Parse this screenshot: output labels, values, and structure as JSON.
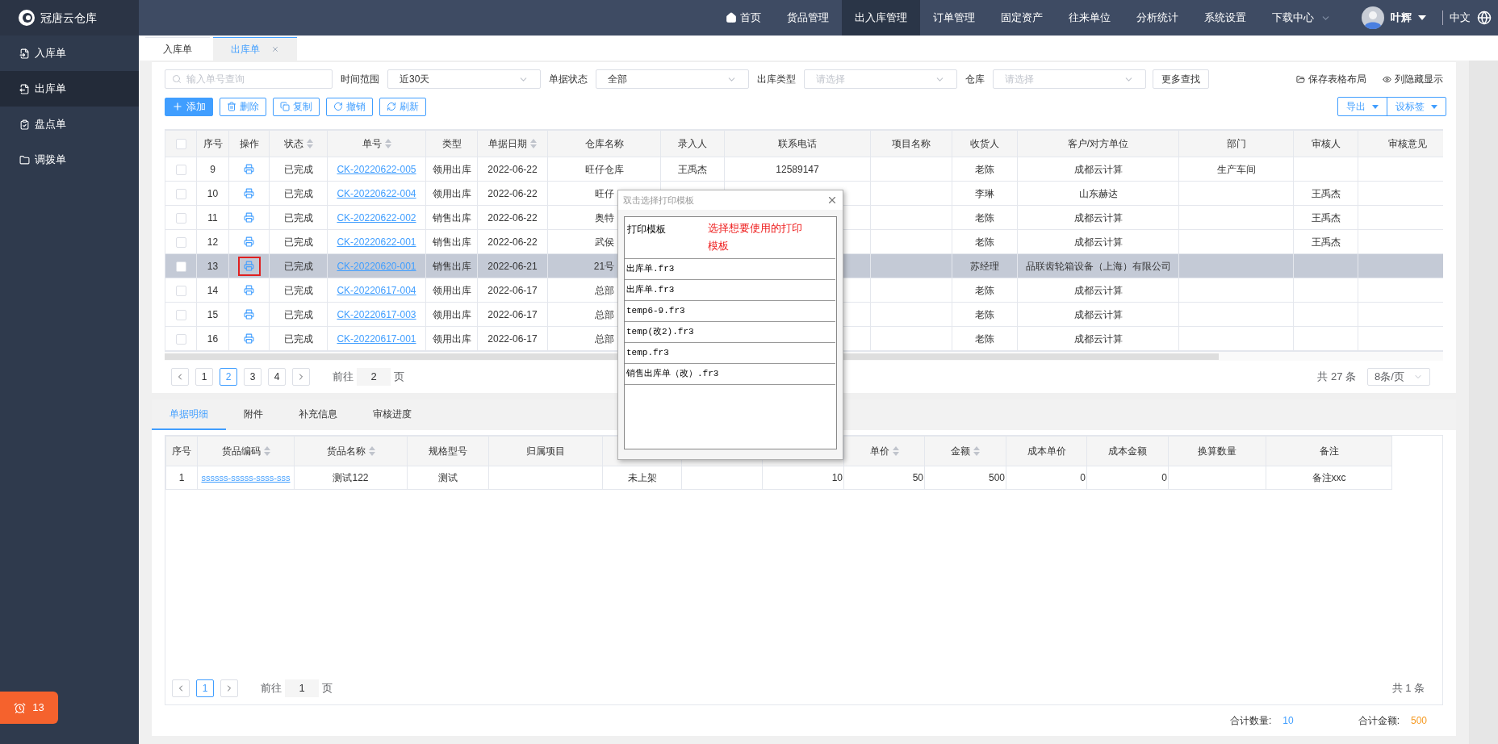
{
  "app": {
    "name": "冠唐云仓库"
  },
  "nav": [
    {
      "label": "首页",
      "selected": false,
      "kind": "home"
    },
    {
      "label": "货品管理",
      "selected": false,
      "kind": "plain"
    },
    {
      "label": "出入库管理",
      "selected": true,
      "kind": "plain"
    },
    {
      "label": "订单管理",
      "selected": false,
      "kind": "plain"
    },
    {
      "label": "固定资产",
      "selected": false,
      "kind": "plain"
    },
    {
      "label": "往来单位",
      "selected": false,
      "kind": "plain"
    },
    {
      "label": "分析统计",
      "selected": false,
      "kind": "plain"
    },
    {
      "label": "系统设置",
      "selected": false,
      "kind": "plain"
    },
    {
      "label": "下载中心",
      "selected": false,
      "kind": "dropdown"
    }
  ],
  "user": {
    "name": "叶辉"
  },
  "language": "中文",
  "sidebar": [
    {
      "label": "入库单",
      "selected": false
    },
    {
      "label": "出库单",
      "selected": true
    },
    {
      "label": "盘点单",
      "selected": false
    },
    {
      "label": "调拨单",
      "selected": false
    }
  ],
  "notification": {
    "count": "13"
  },
  "tabs": [
    {
      "label": "入库单",
      "selected": false,
      "closable": false
    },
    {
      "label": "出库单",
      "selected": true,
      "closable": true
    }
  ],
  "filters": {
    "search_placeholder": "输入单号查询",
    "fields": [
      {
        "label": "时间范围",
        "value": "近30天"
      },
      {
        "label": "单据状态",
        "value": "全部"
      },
      {
        "label": "出库类型",
        "placeholder": "请选择"
      },
      {
        "label": "仓库",
        "placeholder": "请选择"
      }
    ],
    "more": "更多查找"
  },
  "layout_actions": [
    {
      "label": "保存表格布局",
      "kind": "folder"
    },
    {
      "label": "列隐藏显示",
      "kind": "eye"
    }
  ],
  "toolbar": [
    {
      "label": "添加",
      "kind": "add"
    },
    {
      "label": "删除",
      "kind": "delete"
    },
    {
      "label": "复制",
      "kind": "copy"
    },
    {
      "label": "撤销",
      "kind": "undo"
    },
    {
      "label": "刷新",
      "kind": "refresh"
    }
  ],
  "toolbar_right": [
    {
      "label": "导出"
    },
    {
      "label": "设标签"
    }
  ],
  "table": {
    "all_checked": false,
    "columns": [
      {
        "label": "序号",
        "sortable": false
      },
      {
        "label": "操作",
        "sortable": false,
        "kind": "print"
      },
      {
        "label": "状态",
        "sortable": true
      },
      {
        "label": "单号",
        "sortable": true
      },
      {
        "label": "类型",
        "sortable": false
      },
      {
        "label": "单据日期",
        "sortable": true
      },
      {
        "label": "仓库名称",
        "sortable": false
      },
      {
        "label": "录入人",
        "sortable": false
      },
      {
        "label": "联系电话",
        "sortable": false
      },
      {
        "label": "项目名称",
        "sortable": false
      },
      {
        "label": "收货人",
        "sortable": false
      },
      {
        "label": "客户/对方单位",
        "sortable": false
      },
      {
        "label": "部门",
        "sortable": false
      },
      {
        "label": "审核人",
        "sortable": false
      },
      {
        "label": "审核意见",
        "sortable": false
      }
    ],
    "rows": [
      {
        "selected": false,
        "checked": false,
        "print_marked": false,
        "cells": [
          "9",
          "",
          "已完成",
          "CK-20220622-005",
          "领用出库",
          "2022-06-22",
          "旺仔仓库",
          "王禹杰",
          "12589147",
          "",
          "老陈",
          "成都云计算",
          "生产车间",
          "",
          ""
        ]
      },
      {
        "selected": false,
        "checked": false,
        "print_marked": false,
        "cells": [
          "10",
          "",
          "已完成",
          "CK-20220622-004",
          "领用出库",
          "2022-06-22",
          "旺仔",
          "",
          "",
          "",
          "李琳",
          "山东赫达",
          "",
          "王禹杰",
          ""
        ]
      },
      {
        "selected": false,
        "checked": false,
        "print_marked": false,
        "cells": [
          "11",
          "",
          "已完成",
          "CK-20220622-002",
          "销售出库",
          "2022-06-22",
          "奥特",
          "",
          "",
          "",
          "老陈",
          "成都云计算",
          "",
          "王禹杰",
          ""
        ]
      },
      {
        "selected": false,
        "checked": false,
        "print_marked": false,
        "cells": [
          "12",
          "",
          "已完成",
          "CK-20220622-001",
          "销售出库",
          "2022-06-22",
          "武侯",
          "",
          "",
          "",
          "老陈",
          "成都云计算",
          "",
          "王禹杰",
          ""
        ]
      },
      {
        "selected": true,
        "checked": false,
        "print_marked": true,
        "cells": [
          "13",
          "",
          "已完成",
          "CK-20220620-001",
          "销售出库",
          "2022-06-21",
          "21号",
          "",
          "",
          "",
          "苏经理",
          "品联齿轮箱设备（上海）有限公司",
          "",
          "",
          ""
        ]
      },
      {
        "selected": false,
        "checked": false,
        "print_marked": false,
        "cells": [
          "14",
          "",
          "已完成",
          "CK-20220617-004",
          "领用出库",
          "2022-06-17",
          "总部",
          "",
          "",
          "",
          "老陈",
          "成都云计算",
          "",
          "",
          ""
        ]
      },
      {
        "selected": false,
        "checked": false,
        "print_marked": false,
        "cells": [
          "15",
          "",
          "已完成",
          "CK-20220617-003",
          "领用出库",
          "2022-06-17",
          "总部",
          "",
          "",
          "",
          "老陈",
          "成都云计算",
          "",
          "",
          ""
        ]
      },
      {
        "selected": false,
        "checked": false,
        "print_marked": false,
        "cells": [
          "16",
          "",
          "已完成",
          "CK-20220617-001",
          "领用出库",
          "2022-06-17",
          "总部",
          "",
          "",
          "",
          "老陈",
          "成都云计算",
          "",
          "",
          ""
        ]
      }
    ]
  },
  "pagination": {
    "pages": [
      {
        "label": "1",
        "selected": false
      },
      {
        "label": "2",
        "selected": true
      },
      {
        "label": "3",
        "selected": false
      },
      {
        "label": "4",
        "selected": false
      }
    ],
    "goto_label": "前往",
    "goto_value": "2",
    "page_unit": "页",
    "total": "共 27 条",
    "page_size": "8条/页"
  },
  "detail_tabs": [
    {
      "label": "单据明细",
      "selected": true
    },
    {
      "label": "附件",
      "selected": false
    },
    {
      "label": "补充信息",
      "selected": false
    },
    {
      "label": "审核进度",
      "selected": false
    }
  ],
  "detail_table": {
    "columns": [
      {
        "label": "序号",
        "sortable": false
      },
      {
        "label": "货品编码",
        "sortable": true
      },
      {
        "label": "货品名称",
        "sortable": true
      },
      {
        "label": "规格型号",
        "sortable": false
      },
      {
        "label": "归属项目",
        "sortable": false
      },
      {},
      {},
      {},
      {
        "label": "单价",
        "sortable": true
      },
      {
        "label": "金额",
        "sortable": true
      },
      {
        "label": "成本单价",
        "sortable": false
      },
      {
        "label": "成本金额",
        "sortable": false
      },
      {
        "label": "换算数量",
        "sortable": false
      },
      {
        "label": "备注",
        "sortable": false
      }
    ],
    "rows": [
      {
        "cells": [
          "1",
          "ssssss-sssss-ssss-sss",
          "测试122",
          "测试",
          "",
          "未上架",
          "",
          "10",
          "50",
          "500",
          "0",
          "0",
          "",
          "备注xxc"
        ]
      }
    ]
  },
  "detail_pagination": {
    "pages": [
      {
        "label": "1",
        "selected": true
      }
    ],
    "goto_label": "前往",
    "goto_value": "1",
    "page_unit": "页",
    "total": "共 1 条"
  },
  "totals": [
    {
      "label": "合计数量:",
      "value": "10",
      "color": "#409eff"
    },
    {
      "label": "合计金额:",
      "value": "500",
      "color": "#f59a23"
    }
  ],
  "dialog": {
    "title": "双击选择打印模板",
    "header": "打印模板",
    "hint": "选择想要使用的打印模板",
    "templates": [
      "出库单.fr3",
      "出库单.fr3",
      "temp6-9.fr3",
      "temp(改2).fr3",
      "temp.fr3",
      "销售出库单（改）.fr3"
    ]
  }
}
